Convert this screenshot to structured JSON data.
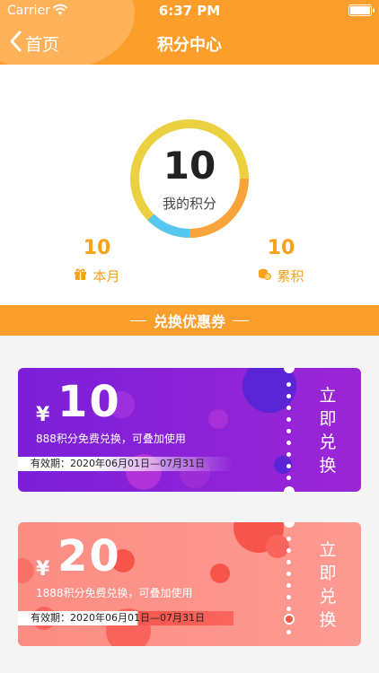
{
  "status_bar": {
    "carrier": "Carrier",
    "time": "6:37 PM"
  },
  "nav": {
    "back_label": "首页",
    "title": "积分中心"
  },
  "points": {
    "value": "10",
    "label": "我的积分",
    "month_value": "10",
    "month_label": "本月",
    "total_value": "10",
    "total_label": "累积"
  },
  "section": {
    "title": "兑换优惠券"
  },
  "coupons": [
    {
      "currency": "¥",
      "amount": "10",
      "description": "888积分免费兑换，可叠加使用",
      "validity": "有效期：2020年06月01日—07月31日",
      "action": "立即兑换"
    },
    {
      "currency": "¥",
      "amount": "20",
      "description": "1888积分免费兑换，可叠加使用",
      "validity": "有效期：2020年06月01日—07月31日",
      "action": "立即兑换"
    }
  ],
  "colors": {
    "accent": "#fc9e2c",
    "points_text": "#f7a11c",
    "coupon1": "#7b1fd8",
    "coupon2": "#fb8d83"
  }
}
